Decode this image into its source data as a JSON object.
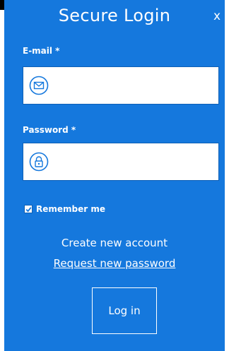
{
  "dialog": {
    "title": "Secure Login",
    "close_label": "x"
  },
  "email": {
    "label": "E-mail *",
    "value": "",
    "placeholder": "",
    "icon": "envelope-icon"
  },
  "password": {
    "label": "Password *",
    "value": "",
    "placeholder": "",
    "icon": "padlock-icon"
  },
  "remember": {
    "label": "Remember me",
    "checked": true
  },
  "links": {
    "create_account": "Create new account",
    "request_password": "Request new password"
  },
  "actions": {
    "login_label": "Log in"
  },
  "colors": {
    "panel_background": "#1578dd",
    "text": "#ffffff",
    "field_background": "#ffffff"
  }
}
